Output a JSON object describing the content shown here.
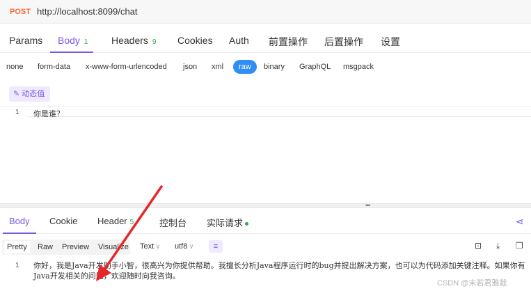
{
  "request": {
    "method": "POST",
    "url": "http://localhost:8099/chat"
  },
  "req_tabs": [
    {
      "label": "Params",
      "count": ""
    },
    {
      "label": "Body",
      "count": "1"
    },
    {
      "label": "Headers",
      "count": "9"
    },
    {
      "label": "Cookies",
      "count": ""
    },
    {
      "label": "Auth",
      "count": ""
    },
    {
      "label": "前置操作",
      "count": ""
    },
    {
      "label": "后置操作",
      "count": ""
    },
    {
      "label": "设置",
      "count": ""
    }
  ],
  "body_types": [
    "none",
    "form-data",
    "x-www-form-urlencoded",
    "json",
    "xml",
    "raw",
    "binary",
    "GraphQL",
    "msgpack"
  ],
  "dynamic_value_label": "动态值",
  "editor": {
    "line_number": "1",
    "content": "你是谁？"
  },
  "resp_tabs": [
    {
      "label": "Body",
      "count": ""
    },
    {
      "label": "Cookie",
      "count": ""
    },
    {
      "label": "Header",
      "count": "5"
    },
    {
      "label": "控制台",
      "count": ""
    },
    {
      "label": "实际请求",
      "count": ""
    }
  ],
  "view_modes": [
    "Pretty",
    "Raw",
    "Preview",
    "Visualize"
  ],
  "format_select": "Text",
  "encoding_select": "utf8",
  "response": {
    "line_number": "1",
    "text": "你好，我是Java开发助手小智，很高兴为你提供帮助。我擅长分析Java程序运行时的bug并提出解决方案，也可以为代码添加关键注释。如果你有Java开发相关的问题，欢迎随时向我咨询。"
  },
  "watermark": "CSDN @末若君雅裁",
  "colors": {
    "accent": "#7b57e6",
    "method": "#f26b3a",
    "raw_active": "#2f8ef5",
    "count_green": "#2fa84f",
    "arrow_red": "#e8262a"
  }
}
